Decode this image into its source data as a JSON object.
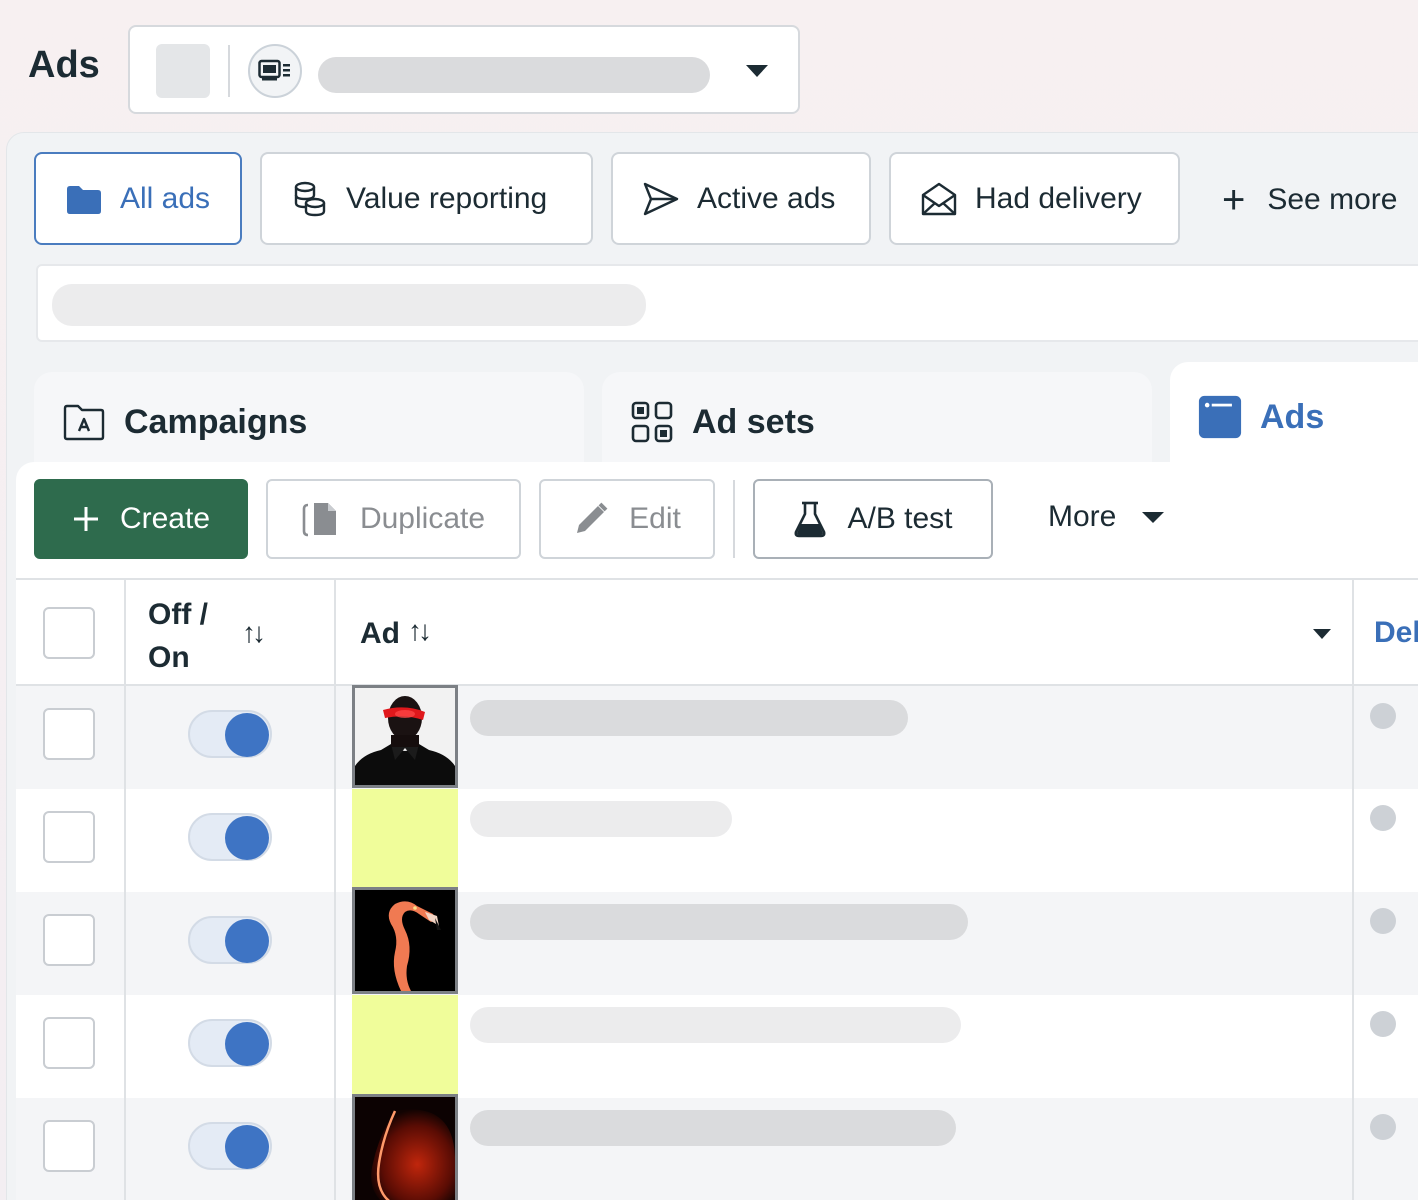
{
  "header": {
    "title": "Ads"
  },
  "views": {
    "all_ads": "All ads",
    "value_reporting": "Value reporting",
    "active_ads": "Active ads",
    "had_delivery": "Had delivery",
    "see_more": "See more"
  },
  "level_tabs": {
    "campaigns": "Campaigns",
    "ad_sets": "Ad sets",
    "ads": "Ads"
  },
  "toolbar": {
    "create": "Create",
    "duplicate": "Duplicate",
    "edit": "Edit",
    "ab_test": "A/B test",
    "more": "More"
  },
  "table": {
    "col_off_on_line1": "Off /",
    "col_off_on_line2": "On",
    "col_ad": "Ad",
    "col_delivery": "Del",
    "rows": [
      {
        "enabled": true,
        "thumbnail": "person-red-visor"
      },
      {
        "enabled": true,
        "thumbnail": "yellow-placeholder"
      },
      {
        "enabled": true,
        "thumbnail": "flamingo"
      },
      {
        "enabled": true,
        "thumbnail": "yellow-placeholder"
      },
      {
        "enabled": true,
        "thumbnail": "red-glow-sphere"
      }
    ]
  },
  "colors": {
    "accent_blue": "#3a6fb8",
    "create_green": "#2e6b4d",
    "toggle_on": "#3e74c4",
    "thumb_yellow": "#f0fd9a"
  }
}
